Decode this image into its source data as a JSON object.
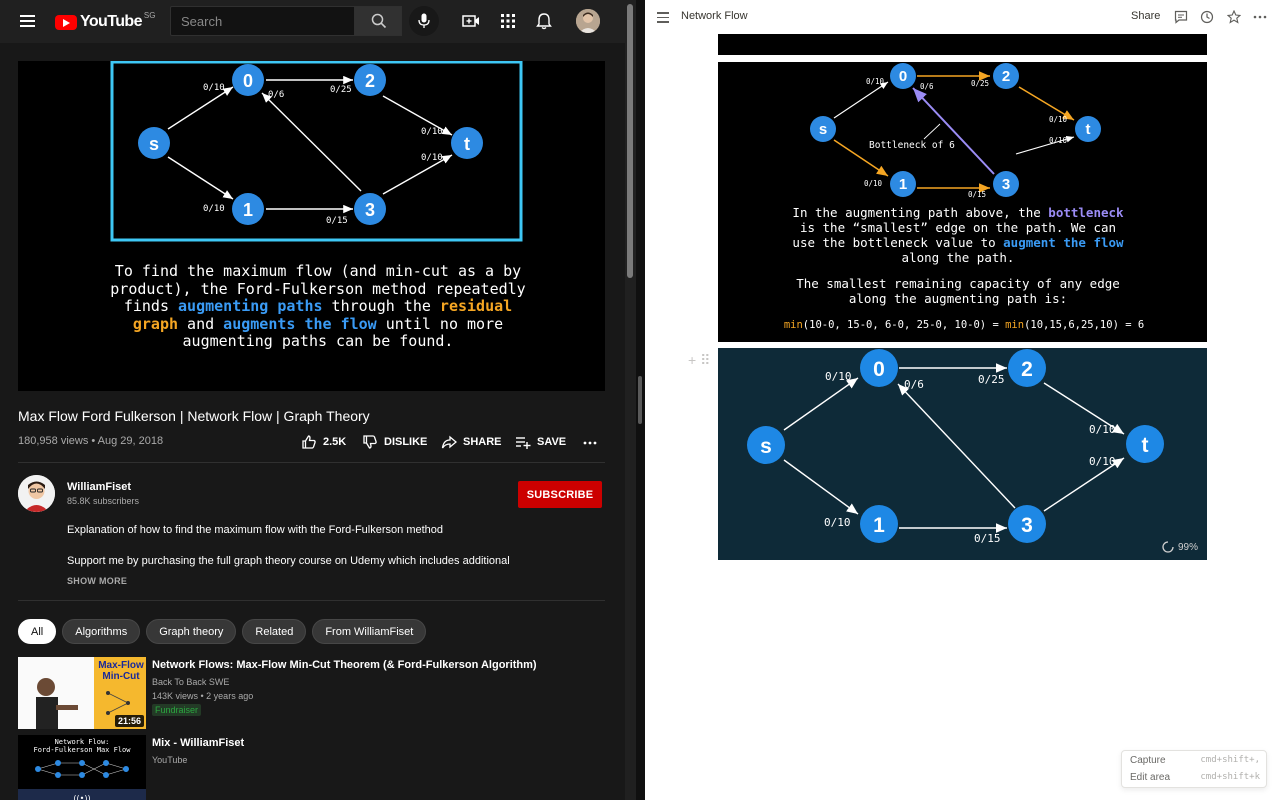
{
  "youtube": {
    "logo_text": "YouTube",
    "country_code": "SG",
    "search_placeholder": "Search",
    "video": {
      "slide_lines": [
        "To find the maximum flow (and min-cut as a by",
        "product), the Ford-Fulkerson method repeatedly"
      ],
      "slide_line3_a": "finds ",
      "slide_line3_b": "augmenting paths",
      "slide_line3_c": " through the ",
      "slide_line3_d": "residual",
      "slide_line4_a": "graph",
      "slide_line4_b": " and ",
      "slide_line4_c": "augments the flow",
      "slide_line4_d": " until no more",
      "slide_line5": "augmenting paths can be found.",
      "graph_edges": {
        "s0": "0/10",
        "s1": "0/10",
        "02": "0/25",
        "30": "0/6",
        "13": "0/15",
        "2t": "0/10",
        "3t": "0/10"
      }
    },
    "title": "Max Flow Ford Fulkerson | Network Flow | Graph Theory",
    "meta": "180,958 views • Aug 29, 2018",
    "likes": "2.5K",
    "dislike_label": "DISLIKE",
    "share_label": "SHARE",
    "save_label": "SAVE",
    "channel": {
      "name": "WilliamFiset",
      "subscribers": "85.8K subscribers",
      "subscribe_label": "SUBSCRIBE"
    },
    "description_1": "Explanation of how to find the maximum flow with the Ford-Fulkerson method",
    "description_2": "Support me by purchasing the full graph theory course on Udemy which includes additional",
    "show_more": "SHOW MORE",
    "chips": [
      "All",
      "Algorithms",
      "Graph theory",
      "Related",
      "From WilliamFiset"
    ],
    "recommendations": [
      {
        "title": "Network Flows: Max-Flow Min-Cut Theorem (& Ford-Fulkerson Algorithm)",
        "channel": "Back To Back SWE",
        "views": "143K views • 2 years ago",
        "badge": "Fundraiser",
        "duration": "21:56",
        "thumb_text_1": "Max-Flow",
        "thumb_text_2": "Min-Cut"
      },
      {
        "title": "Mix - WilliamFiset",
        "channel": "YouTube",
        "thumb_text_1": "Network Flow:",
        "thumb_text_2": "Ford-Fulkerson Max Flow"
      }
    ]
  },
  "notion": {
    "page_title": "Network Flow",
    "share_label": "Share",
    "slide1": {
      "bottleneck_label": "Bottleneck of 6",
      "line1_a": "In the augmenting path above, the ",
      "line1_b": "bottleneck",
      "line2": "is the “smallest” edge on the path. We can",
      "line3_a": "use the bottleneck value to ",
      "line3_b": "augment the flow",
      "line4": "along the path.",
      "line5": "The smallest remaining capacity of any edge",
      "line6": "along the augmenting path is:",
      "formula_a": "min",
      "formula_b": "(10-0, 15-0, 6-0, 25-0, 10-0) = ",
      "formula_c": "min",
      "formula_d": "(10,15,6,25,10) = 6",
      "edges": {
        "s0": "0/10",
        "s1": "0/10",
        "02": "0/25",
        "30": "0/6",
        "13": "0/15",
        "2t": "0/10",
        "3t": "0/10"
      }
    },
    "slide2_edges": {
      "s0": "0/10",
      "s1": "0/10",
      "02": "0/25",
      "30": "0/6",
      "13": "0/15",
      "2t": "0/10",
      "3t": "0/10"
    },
    "loading": "99%",
    "tooltip": [
      {
        "label": "Capture",
        "shortcut": "cmd+shift+,"
      },
      {
        "label": "Edit area",
        "shortcut": "cmd+shift+k"
      }
    ]
  },
  "graph_nodes": [
    "s",
    "0",
    "1",
    "2",
    "3",
    "t"
  ],
  "colors": {
    "node_blue": "#1e88e5",
    "highlight_blue": "#3a9bf5",
    "highlight_orange": "#f5a623",
    "path_purple": "#9b8cf5",
    "subscribe_red": "#cc0000"
  }
}
